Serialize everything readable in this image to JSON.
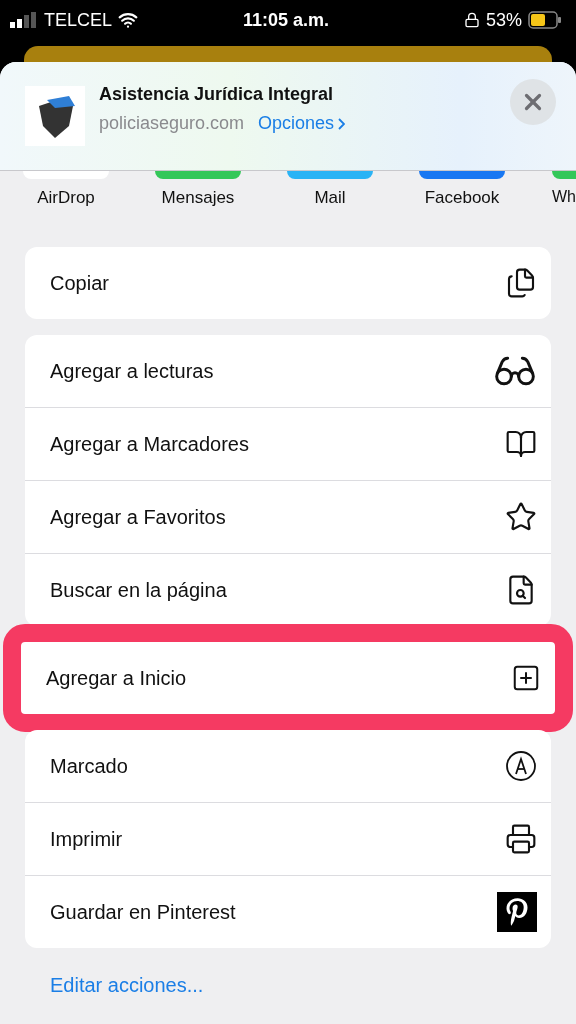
{
  "status_bar": {
    "carrier": "TELCEL",
    "time": "11:05 a.m.",
    "battery": "53%"
  },
  "header": {
    "title": "Asistencia Jurídica Integral",
    "domain": "policiaseguro.com",
    "options": "Opciones"
  },
  "apps": [
    {
      "label": "AirDrop",
      "color": "#ffffff"
    },
    {
      "label": "Mensajes",
      "color": "#34c759"
    },
    {
      "label": "Mail",
      "color": "#2ab3f5"
    },
    {
      "label": "Facebook",
      "color": "#1877f2"
    },
    {
      "label": "Wh",
      "color": "#34c759"
    }
  ],
  "action_groups": [
    {
      "highlighted": false,
      "actions": [
        {
          "label": "Copiar",
          "kind": "copy"
        }
      ]
    },
    {
      "highlighted": false,
      "actions": [
        {
          "label": "Agregar a lecturas",
          "kind": "glasses"
        },
        {
          "label": "Agregar a Marcadores",
          "kind": "book"
        },
        {
          "label": "Agregar a Favoritos",
          "kind": "star"
        },
        {
          "label": "Buscar en la página",
          "kind": "find"
        }
      ]
    },
    {
      "highlighted": true,
      "actions": [
        {
          "label": "Agregar a Inicio",
          "kind": "add"
        }
      ]
    },
    {
      "highlighted": false,
      "actions": [
        {
          "label": "Marcado",
          "kind": "markup"
        },
        {
          "label": "Imprimir",
          "kind": "print"
        },
        {
          "label": "Guardar en Pinterest",
          "kind": "pinterest"
        }
      ]
    }
  ],
  "edit_link": "Editar acciones..."
}
